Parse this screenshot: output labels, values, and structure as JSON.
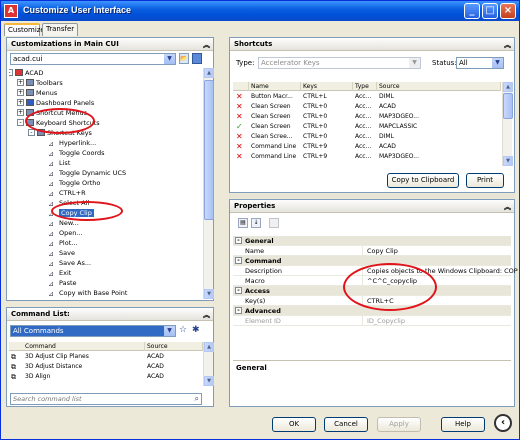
{
  "window": {
    "title": "Customize User Interface"
  },
  "tabs": [
    "Customize",
    "Transfer"
  ],
  "customizations": {
    "header": "Customizations in Main CUI",
    "file_combo": "acad.cui",
    "tree": [
      {
        "label": "ACAD",
        "indent": 0,
        "expander": "-",
        "icon": "gear-icon"
      },
      {
        "label": "Toolbars",
        "indent": 1,
        "expander": "+",
        "icon": "toolbar-icon"
      },
      {
        "label": "Menus",
        "indent": 1,
        "expander": "+",
        "icon": "menu-icon"
      },
      {
        "label": "Dashboard Panels",
        "indent": 1,
        "expander": "+",
        "icon": "dashboard-icon"
      },
      {
        "label": "Shortcut Menus",
        "indent": 1,
        "expander": "+",
        "icon": "menu-icon"
      },
      {
        "label": "Keyboard Shortcuts",
        "indent": 1,
        "expander": "-",
        "icon": "keyboard-icon"
      },
      {
        "label": "Shortcut Keys",
        "indent": 2,
        "expander": "-",
        "icon": "keyboard-icon"
      },
      {
        "label": "Hyperlink...",
        "indent": 3,
        "icon": "command-icon"
      },
      {
        "label": "Toggle Coords",
        "indent": 3,
        "icon": "command-icon"
      },
      {
        "label": "List",
        "indent": 3,
        "icon": "command-icon"
      },
      {
        "label": "Toggle Dynamic UCS",
        "indent": 3,
        "icon": "command-icon"
      },
      {
        "label": "Toggle Ortho",
        "indent": 3,
        "icon": "command-icon"
      },
      {
        "label": "CTRL+R",
        "indent": 3,
        "icon": "command-icon"
      },
      {
        "label": "Select All",
        "indent": 3,
        "icon": "command-icon"
      },
      {
        "label": "Copy Clip",
        "indent": 3,
        "icon": "command-icon",
        "selected": true
      },
      {
        "label": "New...",
        "indent": 3,
        "icon": "command-icon"
      },
      {
        "label": "Open...",
        "indent": 3,
        "icon": "command-icon"
      },
      {
        "label": "Plot...",
        "indent": 3,
        "icon": "command-icon"
      },
      {
        "label": "Save",
        "indent": 3,
        "icon": "command-icon"
      },
      {
        "label": "Save As...",
        "indent": 3,
        "icon": "command-icon"
      },
      {
        "label": "Exit",
        "indent": 3,
        "icon": "command-icon"
      },
      {
        "label": "Paste",
        "indent": 3,
        "icon": "command-icon"
      },
      {
        "label": "Copy with Base Point",
        "indent": 3,
        "icon": "command-icon"
      }
    ]
  },
  "command_list": {
    "header": "Command List:",
    "filter": "All Commands",
    "columns": [
      "Command",
      "Source"
    ],
    "rows": [
      {
        "command": "3D Adjust Clip Planes",
        "source": "ACAD"
      },
      {
        "command": "3D Adjust Distance",
        "source": "ACAD"
      },
      {
        "command": "3D Align",
        "source": "ACAD"
      }
    ],
    "search_placeholder": "Search command list"
  },
  "shortcuts": {
    "header": "Shortcuts",
    "type_label": "Type:",
    "type_value": "Accelerator Keys",
    "status_label": "Status:",
    "status_value": "All",
    "columns": [
      "Name",
      "Keys",
      "Type",
      "Source"
    ],
    "rows": [
      {
        "status": "x",
        "name": "Button Macr...",
        "keys": "CTRL+L",
        "type": "Acc...",
        "source": "DIML"
      },
      {
        "status": "x",
        "name": "Clean Screen",
        "keys": "CTRL+0",
        "type": "Acc...",
        "source": "ACAD"
      },
      {
        "status": "x",
        "name": "Clean Screen",
        "keys": "CTRL+0",
        "type": "Acc...",
        "source": "MAP3DGEO..."
      },
      {
        "status": "check",
        "name": "Clean Screen",
        "keys": "CTRL+0",
        "type": "Acc...",
        "source": "MAPCLASSIC"
      },
      {
        "status": "x",
        "name": "Clean Scree...",
        "keys": "CTRL+0",
        "type": "Acc...",
        "source": "DIML"
      },
      {
        "status": "x",
        "name": "Command Line",
        "keys": "CTRL+9",
        "type": "Acc...",
        "source": "ACAD"
      },
      {
        "status": "x",
        "name": "Command Line",
        "keys": "CTRL+9",
        "type": "Acc...",
        "source": "MAP3DGEO..."
      }
    ],
    "copy_button": "Copy to Clipboard",
    "print_button": "Print"
  },
  "properties": {
    "header": "Properties",
    "rows": [
      {
        "kind": "cat",
        "name": "General"
      },
      {
        "kind": "prop",
        "name": "Name",
        "value": "Copy Clip"
      },
      {
        "kind": "cat",
        "name": "Command"
      },
      {
        "kind": "prop",
        "name": "Description",
        "value": "Copies objects to the Windows Clipboard: COP"
      },
      {
        "kind": "prop",
        "name": "Macro",
        "value": "^C^C_copyclip"
      },
      {
        "kind": "cat",
        "name": "Access"
      },
      {
        "kind": "prop",
        "name": "Key(s)",
        "value": "CTRL+C"
      },
      {
        "kind": "cat",
        "name": "Advanced"
      },
      {
        "kind": "prop",
        "name": "Element ID",
        "value": "ID_Copyclip",
        "disabled": true
      }
    ],
    "footer_label": "General"
  },
  "buttons": {
    "ok": "OK",
    "cancel": "Cancel",
    "apply": "Apply",
    "help": "Help"
  },
  "colors": {
    "title_blue": "#0a5fe0",
    "highlight": "#316ac5",
    "annotation_red": "#e0141a"
  }
}
